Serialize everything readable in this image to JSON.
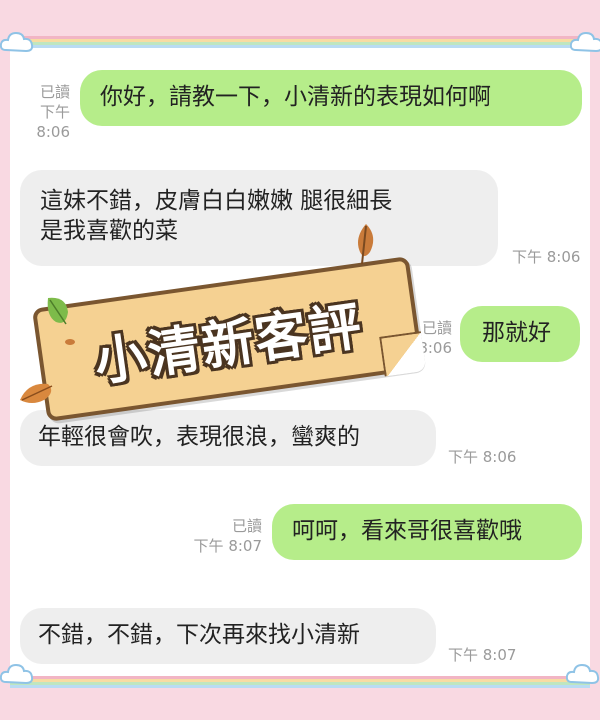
{
  "banner": {
    "title": "小清新客評"
  },
  "messages": [
    {
      "side": "right",
      "text": "你好，請教一下，小清新的表現如何啊",
      "read": "已讀",
      "time": "下午 8:06"
    },
    {
      "side": "left",
      "line1": "這妹不錯，皮膚白白嫩嫩 腿很細長",
      "line2": "是我喜歡的菜",
      "time": "下午 8:06"
    },
    {
      "side": "right",
      "text": "那就好",
      "read": "已讀",
      "time": "8:06"
    },
    {
      "side": "left",
      "text": "年輕很會吹，表現很浪，蠻爽的",
      "time": "下午 8:06"
    },
    {
      "side": "right",
      "text": "呵呵，看來哥很喜歡哦",
      "read": "已讀",
      "time": "下午 8:07"
    },
    {
      "side": "left",
      "text": "不錯，不錯，下次再來找小清新",
      "time": "下午 8:07"
    }
  ],
  "colors": {
    "background": "#f9d9e2",
    "outgoing_bubble": "#b6ed8a",
    "incoming_bubble": "#eeeeee",
    "meta_text": "#9a9a9a",
    "banner_fill": "#f5d192",
    "banner_border": "#7a5630"
  },
  "icons": [
    "cloud-icon",
    "leaf-icon"
  ]
}
